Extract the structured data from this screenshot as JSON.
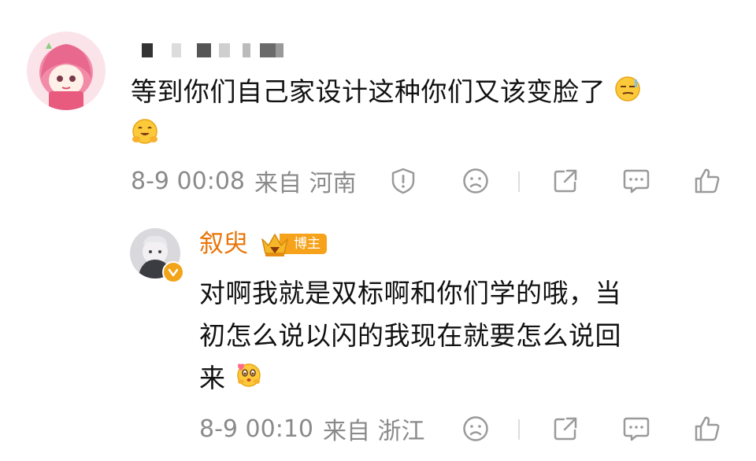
{
  "comment": {
    "text": "等到你们自己家设计这种你们又该变脸了",
    "time": "8-9 00:08",
    "location": "来自 河南",
    "emoji_1": "smirk-emoji",
    "emoji_2": "hug-emoji"
  },
  "reply": {
    "username": "叙臾",
    "badge": "博主",
    "line_1": "对啊我就是双标啊和你们学的哦，当",
    "line_2": "初怎么说以闪的我现在就要怎么说回",
    "line_3": "来",
    "time": "8-9 00:10",
    "location": "来自 浙江",
    "emoji": "love-kiss-emoji"
  },
  "icons": {
    "report": "report-icon",
    "dislike": "dislike-face-icon",
    "share": "share-icon",
    "reply": "comment-icon",
    "like": "thumbs-up-icon"
  },
  "colors": {
    "accent_orange": "#e8760a",
    "badge_orange": "#f6a21a",
    "meta_gray": "#8a8a8a",
    "icon_gray": "#9a9a9a"
  }
}
